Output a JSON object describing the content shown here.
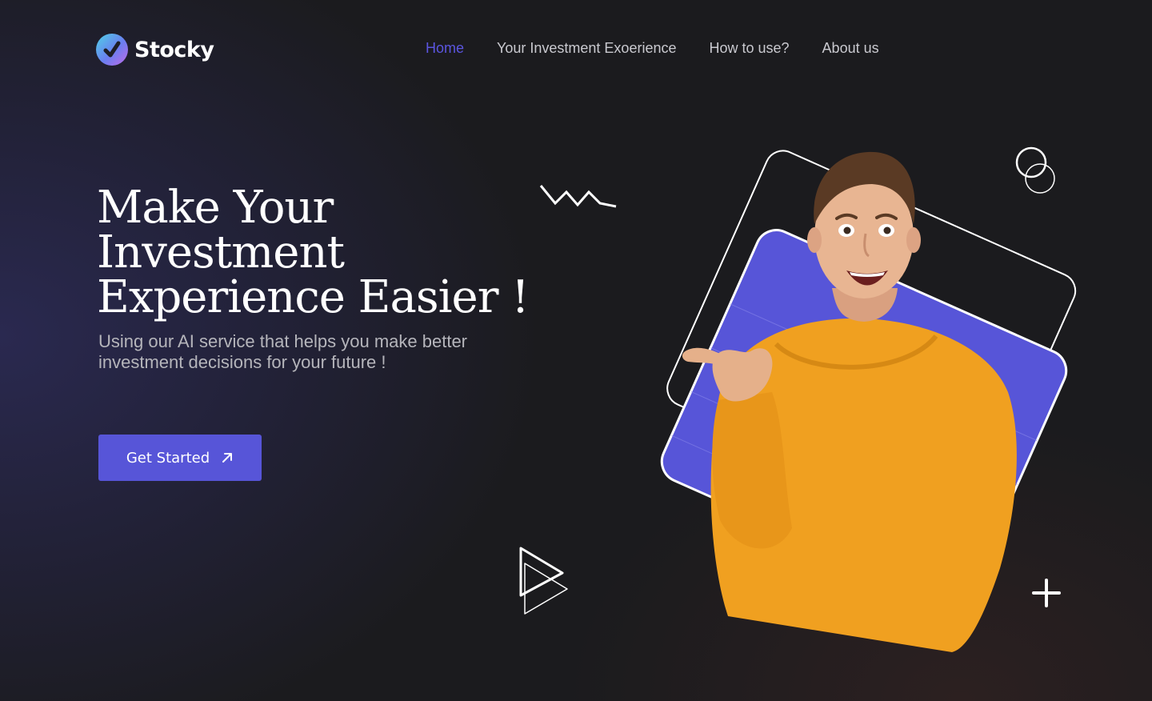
{
  "brand": {
    "name": "Stocky"
  },
  "nav": {
    "items": [
      {
        "label": "Home",
        "active": true
      },
      {
        "label": "Your Investment Exoerience"
      },
      {
        "label": "How to use?"
      },
      {
        "label": "About us"
      }
    ]
  },
  "hero": {
    "headline_lines": [
      "Make Your",
      "Investment",
      "Experience Easier !"
    ],
    "subtitle_lines": [
      "Using our AI service that helps you make better",
      "investment decisions for your future !"
    ],
    "cta_label": "Get Started",
    "cta_icon": "arrow-up-right-icon"
  },
  "colors": {
    "accent": "#5755d8",
    "nav_active": "#5b55e0",
    "shirt": "#f0a020",
    "background": "#1b1b1e"
  }
}
